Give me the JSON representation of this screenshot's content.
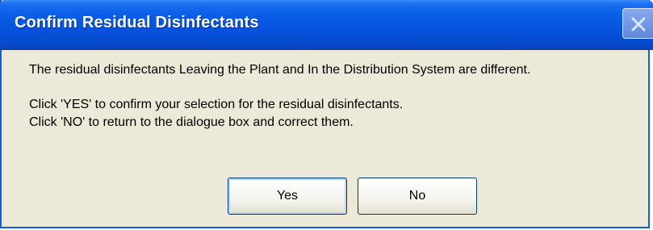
{
  "dialog": {
    "title": "Confirm Residual Disinfectants",
    "close_icon": "close-icon",
    "message_line1": "The residual disinfectants Leaving the Plant and In the Distribution System are different.",
    "message_line2": "Click 'YES' to confirm your selection for the residual disinfectants.",
    "message_line3": "Click 'NO' to return to the dialogue box and correct them.",
    "yes_label": "Yes",
    "no_label": "No"
  },
  "colors": {
    "titlebar": "#0652dd",
    "body": "#ece9d8",
    "button_border": "#003c74"
  }
}
